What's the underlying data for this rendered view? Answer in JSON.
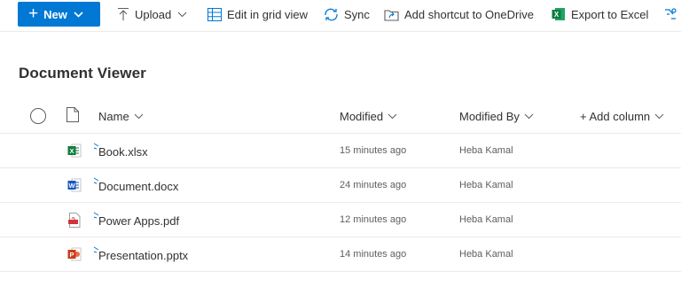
{
  "toolbar": {
    "new_label": "New",
    "upload_label": "Upload",
    "grid_label": "Edit in grid view",
    "sync_label": "Sync",
    "shortcut_label": "Add shortcut to OneDrive",
    "export_label": "Export to Excel"
  },
  "page": {
    "title": "Document Viewer"
  },
  "table": {
    "columns": {
      "name": "Name",
      "modified": "Modified",
      "modified_by": "Modified By",
      "add_column": "+ Add column"
    },
    "rows": [
      {
        "name": "Book.xlsx",
        "modified": "15 minutes ago",
        "modified_by": "Heba Kamal",
        "type": "excel-file-icon"
      },
      {
        "name": "Document.docx",
        "modified": "24 minutes ago",
        "modified_by": "Heba Kamal",
        "type": "word-file-icon"
      },
      {
        "name": "Power Apps.pdf",
        "modified": "12 minutes ago",
        "modified_by": "Heba Kamal",
        "type": "pdf-file-icon"
      },
      {
        "name": "Presentation.pptx",
        "modified": "14 minutes ago",
        "modified_by": "Heba Kamal",
        "type": "powerpoint-file-icon"
      }
    ]
  },
  "colors": {
    "accent": "#0078d4",
    "excel": "#107c41",
    "word": "#185abd",
    "pdf": "#d13438",
    "powerpoint": "#c43e1c"
  }
}
